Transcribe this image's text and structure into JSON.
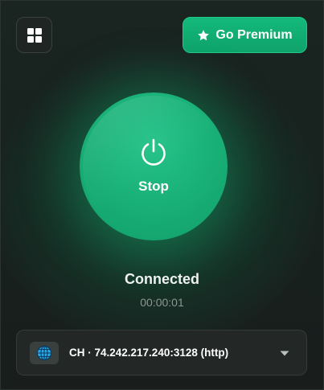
{
  "header": {
    "menu_icon": "grid-icon",
    "premium_label": "Go Premium",
    "premium_icon": "star-icon"
  },
  "connection": {
    "power_icon": "power-icon",
    "button_label": "Stop",
    "status": "Connected",
    "elapsed": "00:00:01"
  },
  "server": {
    "icon": "globe-icon",
    "label": "CH · 74.242.217.240:3128 (http)",
    "dropdown_icon": "caret-down-icon"
  },
  "colors": {
    "accent": "#14b077",
    "background": "#1a2421",
    "panel": "#232826"
  }
}
